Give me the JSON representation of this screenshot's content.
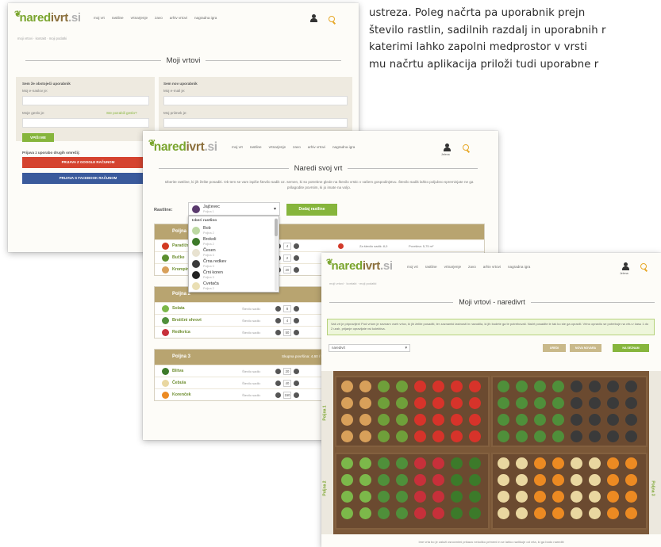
{
  "article": {
    "lines": [
      "ustreza. Poleg načrta pa uporabnik prejn",
      "število rastlin, sadilnih razdalj in uporabnih r",
      "katerimi lahko zapolni medprostor v vrsti",
      "mu načrtu aplikacija priloži tudi uporabne r"
    ]
  },
  "site": {
    "logo_a": "nared",
    "logo_b": "ivrt",
    "logo_c": ".si",
    "nav": [
      "moj vrt",
      "rastline",
      "vrtnarjenje",
      "zavo",
      "arhiv vrtovi",
      "nagradna igra"
    ],
    "user_label": "Jelena",
    "breadcrumb": "moji vrtovi  ·  kontakt  ·  moji podatki"
  },
  "login": {
    "title": "Moji vrtovi",
    "existing_title": "Sem že obstoječi uporabnik",
    "email_label": "Moj e-naslov je:",
    "password_label": "Moje geslo je:",
    "forgot_link": "Ste pozabili geslo?",
    "submit": "VPIŠI ME",
    "new_title": "Sem nov uporabnik",
    "new_email_label": "Moj e-mail je:",
    "new_name_label": "Moj priimek je:",
    "social_title": "Prijava z uporabo drugih omrežij:",
    "google_button": "PRIJAVA Z GOOGLE RAČUNOM",
    "facebook_button": "PRIJAVA S FACEBOOK RAČUNOM",
    "colors": {
      "green": "#86b53c",
      "google": "#d5432f",
      "facebook": "#3a5a9c"
    }
  },
  "planner": {
    "title": "Naredi svoj vrt",
    "intro": "Izberite rastline, ki jih želite posaditi. Ob tem se vam ispiše število sadik oz. semen, ki so potrebne glede na število vrstic v vašem gospodinjstvu. Število sadik lahko poljubno spreminjate ne ga prilagodite povrsim, ki jo imate na voljo.",
    "plant_label": "Rastline:",
    "selected_plant": "Jajčevec",
    "selected_sub": "Poljna 1",
    "add_button": "Dodaj rastline",
    "dropdown_head": "Izberi rastlino",
    "dropdown_items": [
      {
        "name": "Bob",
        "sub": "Poljna 2",
        "color": "#bcd8a2"
      },
      {
        "name": "Brokoli",
        "sub": "Poljna 2",
        "color": "#3d7a2a"
      },
      {
        "name": "Česen",
        "sub": "Poljna 3",
        "color": "#e8e2d0"
      },
      {
        "name": "Črna redkev",
        "sub": "Poljna 3",
        "color": "#3a3a3a"
      },
      {
        "name": "Črni koren",
        "sub": "Poljna 3",
        "color": "#222222"
      },
      {
        "name": "Cvetača",
        "sub": "Poljna 2",
        "color": "#eadfb4"
      }
    ],
    "beds": [
      {
        "name": "Poljna 1",
        "info": "",
        "rows": [
          {
            "name": "Paradižnik",
            "value": "4",
            "color": "#d23a22",
            "stat1": "Za število sadik: 8,0",
            "stat2": "Površina: 5,75 m²"
          },
          {
            "name": "Bučke",
            "value": "2",
            "color": "#5c8f2e",
            "stat1": "",
            "stat2": ""
          },
          {
            "name": "Krompir",
            "value": "20",
            "color": "#d8a05a",
            "stat1": "",
            "stat2": ""
          }
        ]
      },
      {
        "name": "Poljna 2",
        "info": "",
        "rows": [
          {
            "name": "Solata",
            "value": "8",
            "color": "#7cb84a",
            "stat1": "",
            "stat2": ""
          },
          {
            "name": "Brstični ohrovt",
            "value": "4",
            "color": "#4f8f3a",
            "stat1": "",
            "stat2": ""
          },
          {
            "name": "Redkvica",
            "value": "50",
            "color": "#c7303a",
            "stat1": "",
            "stat2": ""
          }
        ]
      },
      {
        "name": "Poljna 3",
        "info": "Skupna površina: 4,60 / 5,00 m²",
        "rows": [
          {
            "name": "Blitva",
            "value": "20",
            "color": "#3c7a2a",
            "stat1": "",
            "stat2": ""
          },
          {
            "name": "Čebula",
            "value": "40",
            "color": "#e9d7a0",
            "stat1": "",
            "stat2": ""
          },
          {
            "name": "Korenček",
            "value": "150",
            "color": "#ec8a22",
            "stat1": "",
            "stat2": ""
          }
        ]
      }
    ],
    "counter_label": "Število sadik:"
  },
  "garden": {
    "title": "Moji vrtovi - naredivrt",
    "note": "Vaš vrt je pripravljen! Pod vrtom je seznam vseh vrtov, ki jih želite posaditi, ter zaznamki lastnosti in navodila, ki jih bodete ga te potrebovali. Načrt posadite le tak ko ste ga opravili. Vrtno opravilo se potrebuje na vrtu v času 1 do 2 urah, prijanje opravljate vsi kolektiva.",
    "select_value": "naredivrt",
    "buttons": [
      "UREDI",
      "NOVA NOVARA",
      "NA SEZNAM"
    ],
    "button_colors": [
      "#c9b98a",
      "#c9b98a",
      "#86b53c"
    ],
    "bed_labels": [
      "Poljna 1",
      "Poljna 2",
      "Poljna 3"
    ],
    "footer": "Ime vrta bo je založi osnovnimi prikazu nekoliko primeni in se lahko razlikuje od vrta, ki ga bodo narediti"
  }
}
